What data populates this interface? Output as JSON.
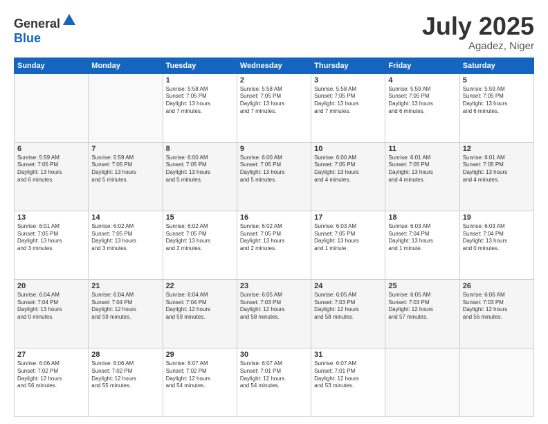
{
  "logo": {
    "text_general": "General",
    "text_blue": "Blue"
  },
  "header": {
    "month": "July 2025",
    "location": "Agadez, Niger"
  },
  "weekdays": [
    "Sunday",
    "Monday",
    "Tuesday",
    "Wednesday",
    "Thursday",
    "Friday",
    "Saturday"
  ],
  "weeks": [
    [
      {
        "day": "",
        "lines": []
      },
      {
        "day": "",
        "lines": []
      },
      {
        "day": "1",
        "lines": [
          "Sunrise: 5:58 AM",
          "Sunset: 7:05 PM",
          "Daylight: 13 hours",
          "and 7 minutes."
        ]
      },
      {
        "day": "2",
        "lines": [
          "Sunrise: 5:58 AM",
          "Sunset: 7:05 PM",
          "Daylight: 13 hours",
          "and 7 minutes."
        ]
      },
      {
        "day": "3",
        "lines": [
          "Sunrise: 5:58 AM",
          "Sunset: 7:05 PM",
          "Daylight: 13 hours",
          "and 7 minutes."
        ]
      },
      {
        "day": "4",
        "lines": [
          "Sunrise: 5:59 AM",
          "Sunset: 7:05 PM",
          "Daylight: 13 hours",
          "and 6 minutes."
        ]
      },
      {
        "day": "5",
        "lines": [
          "Sunrise: 5:59 AM",
          "Sunset: 7:05 PM",
          "Daylight: 13 hours",
          "and 6 minutes."
        ]
      }
    ],
    [
      {
        "day": "6",
        "lines": [
          "Sunrise: 5:59 AM",
          "Sunset: 7:05 PM",
          "Daylight: 13 hours",
          "and 6 minutes."
        ]
      },
      {
        "day": "7",
        "lines": [
          "Sunrise: 5:59 AM",
          "Sunset: 7:05 PM",
          "Daylight: 13 hours",
          "and 5 minutes."
        ]
      },
      {
        "day": "8",
        "lines": [
          "Sunrise: 6:00 AM",
          "Sunset: 7:05 PM",
          "Daylight: 13 hours",
          "and 5 minutes."
        ]
      },
      {
        "day": "9",
        "lines": [
          "Sunrise: 6:00 AM",
          "Sunset: 7:05 PM",
          "Daylight: 13 hours",
          "and 5 minutes."
        ]
      },
      {
        "day": "10",
        "lines": [
          "Sunrise: 6:00 AM",
          "Sunset: 7:05 PM",
          "Daylight: 13 hours",
          "and 4 minutes."
        ]
      },
      {
        "day": "11",
        "lines": [
          "Sunrise: 6:01 AM",
          "Sunset: 7:05 PM",
          "Daylight: 13 hours",
          "and 4 minutes."
        ]
      },
      {
        "day": "12",
        "lines": [
          "Sunrise: 6:01 AM",
          "Sunset: 7:05 PM",
          "Daylight: 13 hours",
          "and 4 minutes."
        ]
      }
    ],
    [
      {
        "day": "13",
        "lines": [
          "Sunrise: 6:01 AM",
          "Sunset: 7:05 PM",
          "Daylight: 13 hours",
          "and 3 minutes."
        ]
      },
      {
        "day": "14",
        "lines": [
          "Sunrise: 6:02 AM",
          "Sunset: 7:05 PM",
          "Daylight: 13 hours",
          "and 3 minutes."
        ]
      },
      {
        "day": "15",
        "lines": [
          "Sunrise: 6:02 AM",
          "Sunset: 7:05 PM",
          "Daylight: 13 hours",
          "and 2 minutes."
        ]
      },
      {
        "day": "16",
        "lines": [
          "Sunrise: 6:02 AM",
          "Sunset: 7:05 PM",
          "Daylight: 13 hours",
          "and 2 minutes."
        ]
      },
      {
        "day": "17",
        "lines": [
          "Sunrise: 6:03 AM",
          "Sunset: 7:05 PM",
          "Daylight: 13 hours",
          "and 1 minute."
        ]
      },
      {
        "day": "18",
        "lines": [
          "Sunrise: 6:03 AM",
          "Sunset: 7:04 PM",
          "Daylight: 13 hours",
          "and 1 minute."
        ]
      },
      {
        "day": "19",
        "lines": [
          "Sunrise: 6:03 AM",
          "Sunset: 7:04 PM",
          "Daylight: 13 hours",
          "and 0 minutes."
        ]
      }
    ],
    [
      {
        "day": "20",
        "lines": [
          "Sunrise: 6:04 AM",
          "Sunset: 7:04 PM",
          "Daylight: 13 hours",
          "and 0 minutes."
        ]
      },
      {
        "day": "21",
        "lines": [
          "Sunrise: 6:04 AM",
          "Sunset: 7:04 PM",
          "Daylight: 12 hours",
          "and 59 minutes."
        ]
      },
      {
        "day": "22",
        "lines": [
          "Sunrise: 6:04 AM",
          "Sunset: 7:04 PM",
          "Daylight: 12 hours",
          "and 59 minutes."
        ]
      },
      {
        "day": "23",
        "lines": [
          "Sunrise: 6:05 AM",
          "Sunset: 7:03 PM",
          "Daylight: 12 hours",
          "and 58 minutes."
        ]
      },
      {
        "day": "24",
        "lines": [
          "Sunrise: 6:05 AM",
          "Sunset: 7:03 PM",
          "Daylight: 12 hours",
          "and 58 minutes."
        ]
      },
      {
        "day": "25",
        "lines": [
          "Sunrise: 6:05 AM",
          "Sunset: 7:03 PM",
          "Daylight: 12 hours",
          "and 57 minutes."
        ]
      },
      {
        "day": "26",
        "lines": [
          "Sunrise: 6:06 AM",
          "Sunset: 7:03 PM",
          "Daylight: 12 hours",
          "and 56 minutes."
        ]
      }
    ],
    [
      {
        "day": "27",
        "lines": [
          "Sunrise: 6:06 AM",
          "Sunset: 7:02 PM",
          "Daylight: 12 hours",
          "and 56 minutes."
        ]
      },
      {
        "day": "28",
        "lines": [
          "Sunrise: 6:06 AM",
          "Sunset: 7:02 PM",
          "Daylight: 12 hours",
          "and 55 minutes."
        ]
      },
      {
        "day": "29",
        "lines": [
          "Sunrise: 6:07 AM",
          "Sunset: 7:02 PM",
          "Daylight: 12 hours",
          "and 54 minutes."
        ]
      },
      {
        "day": "30",
        "lines": [
          "Sunrise: 6:07 AM",
          "Sunset: 7:01 PM",
          "Daylight: 12 hours",
          "and 54 minutes."
        ]
      },
      {
        "day": "31",
        "lines": [
          "Sunrise: 6:07 AM",
          "Sunset: 7:01 PM",
          "Daylight: 12 hours",
          "and 53 minutes."
        ]
      },
      {
        "day": "",
        "lines": []
      },
      {
        "day": "",
        "lines": []
      }
    ]
  ]
}
